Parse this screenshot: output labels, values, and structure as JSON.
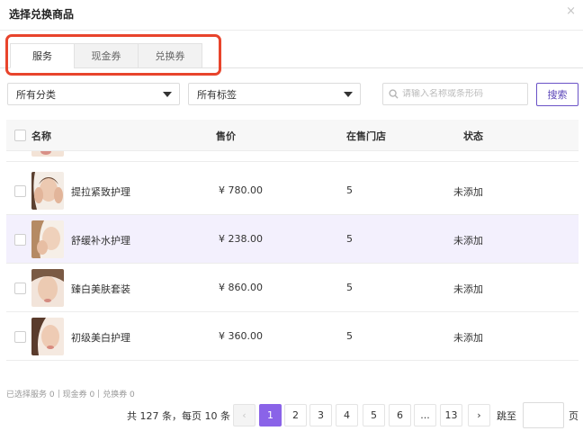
{
  "modal": {
    "title": "选择兑换商品",
    "close_glyph": "×"
  },
  "tabs": [
    {
      "label": "服务",
      "active": true
    },
    {
      "label": "现金券",
      "active": false
    },
    {
      "label": "兑换券",
      "active": false
    }
  ],
  "filters": {
    "category": "所有分类",
    "tag": "所有标签",
    "search_placeholder": "请输入名称或条形码",
    "search_button": "搜索"
  },
  "table": {
    "headers": {
      "name": "名称",
      "price": "售价",
      "stores": "在售门店",
      "status": "状态"
    },
    "rows": [
      {
        "name": "提拉紧致护理",
        "price": "¥ 780.00",
        "stores": "5",
        "status": "未添加",
        "highlighted": false
      },
      {
        "name": "舒缓补水护理",
        "price": "¥ 238.00",
        "stores": "5",
        "status": "未添加",
        "highlighted": true
      },
      {
        "name": "臻白美肤套装",
        "price": "¥ 860.00",
        "stores": "5",
        "status": "未添加",
        "highlighted": false
      },
      {
        "name": "初级美白护理",
        "price": "¥ 360.00",
        "stores": "5",
        "status": "未添加",
        "highlighted": false
      }
    ]
  },
  "selection_summary": {
    "services": "已选择服务 0",
    "cash": "现金券 0",
    "exchange": "兑换券 0"
  },
  "pagination": {
    "total_text": "共 127 条，每页 10 条",
    "pages": [
      "1",
      "2",
      "3",
      "4",
      "5",
      "6",
      "...",
      "13"
    ],
    "current": "1",
    "prev_glyph": "‹",
    "next_glyph": "›",
    "jump_label": "跳至",
    "page_unit": "页"
  },
  "colors": {
    "accent": "#8a63e8",
    "tab_highlight": "#e8442c",
    "row_highlight": "#f3f0fd"
  },
  "icons": {
    "search": "search-icon",
    "dropdown": "caret-down-icon",
    "close": "close-icon",
    "prev": "chevron-left-icon",
    "next": "chevron-right-icon"
  }
}
